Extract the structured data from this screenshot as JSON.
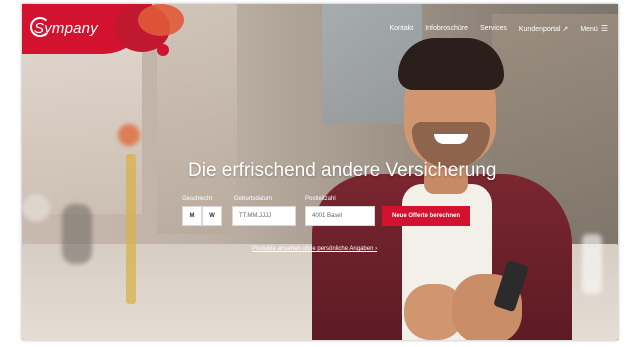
{
  "brand": {
    "logo_text": "Sympany",
    "primary_color": "#d2122e"
  },
  "nav": {
    "items": [
      "Kontakt",
      "Infobroschüre",
      "Services",
      "Kundenportal ↗",
      "Menü"
    ],
    "menu_icon": "hamburger-icon"
  },
  "hero": {
    "headline": "Die erfrischend andere Versicherung"
  },
  "form": {
    "labels": {
      "gender": "Geschlecht",
      "birthdate": "Geburtsdatum",
      "postcode": "Postleitzahl"
    },
    "gender_options": [
      "M",
      "W"
    ],
    "birthdate_placeholder": "TT.MM.JJJJ",
    "postcode_value": "4001 Basel",
    "submit_label": "Neue Offerte berechnen"
  },
  "links": {
    "products_without_details": "Produkte ansehen ohne persönliche Angaben ›"
  }
}
